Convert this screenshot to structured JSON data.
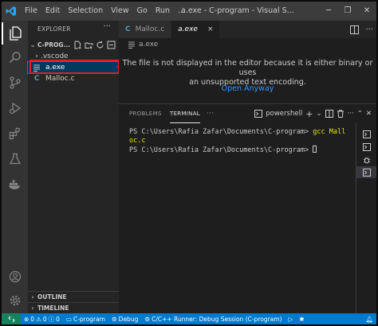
{
  "app": {
    "menu": [
      "File",
      "Edit",
      "Selection",
      "View",
      "Go",
      "Run",
      "..."
    ],
    "window_title": "a.exe - C-program - Visual S...",
    "window_controls": [
      "minimize-icon",
      "restore-icon",
      "close-icon"
    ]
  },
  "sidebar": {
    "title": "EXPLORER",
    "more": "···",
    "project": "C-PROG...",
    "items": [
      {
        "label": ".vscode",
        "icon": "chevron-right-icon"
      },
      {
        "label": "a.exe",
        "icon": "binary-file-icon",
        "selected": true
      },
      {
        "label": "Malloc.c",
        "icon": "c-file-icon"
      }
    ],
    "outline": "OUTLINE",
    "timeline": "TIMELINE"
  },
  "tabs": [
    {
      "label": "Malloc.c",
      "active": false,
      "icon_letter": "C"
    },
    {
      "label": "a.exe",
      "active": true,
      "close": "×"
    }
  ],
  "breadcrumb": "a.exe",
  "editor": {
    "message_line1": "The file is not displayed in the editor because it is either binary or uses",
    "message_line2": "an unsupported text encoding.",
    "open_anyway": "Open Anyway"
  },
  "panel": {
    "tabs": [
      "PROBLEMS",
      "TERMINAL",
      "···"
    ],
    "active_tab": "TERMINAL",
    "shell": "powershell",
    "terminal_lines": [
      {
        "prompt": "PS C:\\Users\\Rafia Zafar\\Documents\\C-program> ",
        "command": "gcc Mall"
      },
      {
        "prompt": "oc.c",
        "command": ""
      },
      {
        "prompt": "PS C:\\Users\\Rafia Zafar\\Documents\\C-program> ",
        "command": ""
      }
    ]
  },
  "status": {
    "errors": "0",
    "warnings": "0",
    "info": "0",
    "folder": "C-program",
    "debug": "Debug",
    "runner": "C/C++ Runner: Debug Session (C-program)"
  },
  "colors": {
    "accent": "#007acc",
    "selection": "#04395e",
    "highlight": "#e02020",
    "link": "#3794ff"
  }
}
